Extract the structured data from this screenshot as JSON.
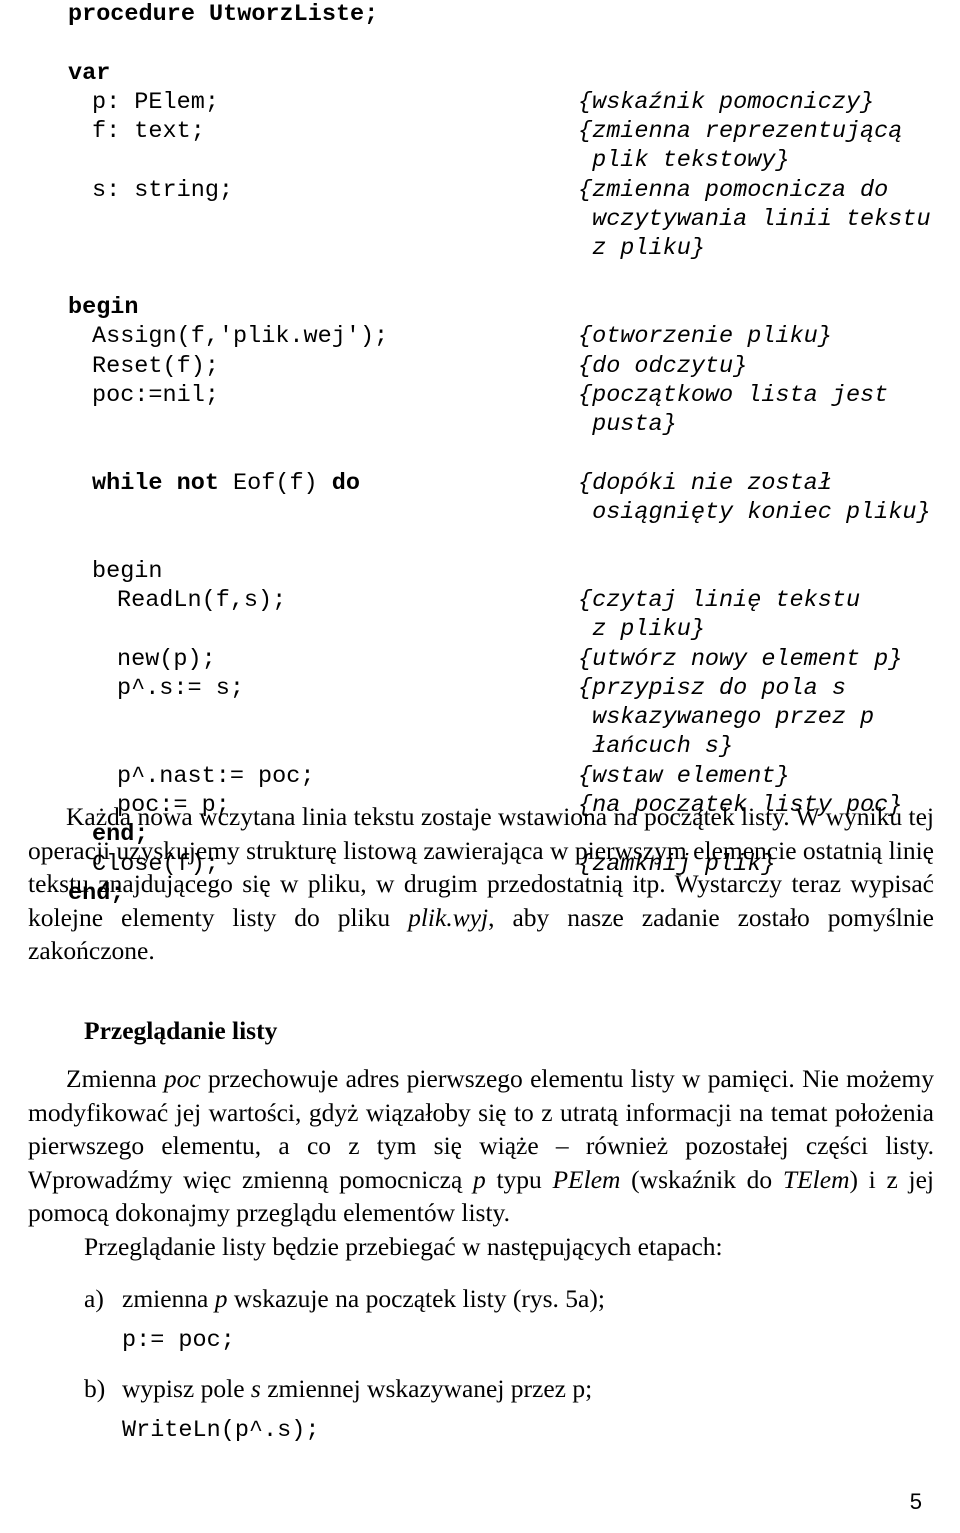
{
  "document": {
    "language": "pl",
    "page_number": "5"
  },
  "code_listing": {
    "name": "UtworzListe procedure",
    "lines": [
      {
        "indent": 0,
        "code": "procedure UtworzListe;",
        "bold": true,
        "comment": ""
      },
      {
        "indent": 0,
        "code": "",
        "bold": false,
        "comment": ""
      },
      {
        "indent": 0,
        "code": "var",
        "bold": true,
        "comment": ""
      },
      {
        "indent": 1,
        "code": "p: PElem;",
        "bold": false,
        "comment": "{wskaźnik pomocniczy}"
      },
      {
        "indent": 1,
        "code": "f: text;",
        "bold": false,
        "comment": "{zmienna reprezentującą"
      },
      {
        "indent": 0,
        "code": "",
        "bold": false,
        "comment": " plik tekstowy}"
      },
      {
        "indent": 1,
        "code": "s: string;",
        "bold": false,
        "comment": "{zmienna pomocnicza do"
      },
      {
        "indent": 0,
        "code": "",
        "bold": false,
        "comment": " wczytywania linii tekstu"
      },
      {
        "indent": 0,
        "code": "",
        "bold": false,
        "comment": " z pliku}"
      },
      {
        "indent": 0,
        "code": "",
        "bold": false,
        "comment": ""
      },
      {
        "indent": 0,
        "code": "begin",
        "bold": true,
        "comment": ""
      },
      {
        "indent": 1,
        "code": "Assign(f,'plik.wej');",
        "bold": false,
        "comment": "{otworzenie pliku}"
      },
      {
        "indent": 1,
        "code": "Reset(f);",
        "bold": false,
        "comment": "{do odczytu}"
      },
      {
        "indent": 1,
        "code": "poc:=nil;",
        "bold": false,
        "comment": "{początkowo lista jest"
      },
      {
        "indent": 0,
        "code": "",
        "bold": false,
        "comment": " pusta}"
      },
      {
        "indent": 0,
        "code": "",
        "bold": false,
        "comment": ""
      },
      {
        "indent": 1,
        "code": "while not Eof(f) do",
        "bold": false,
        "comment": "{dopóki nie został",
        "segments": [
          {
            "text": "while not ",
            "bold": true
          },
          {
            "text": "Eof(f) ",
            "bold": false
          },
          {
            "text": "do",
            "bold": true
          }
        ]
      },
      {
        "indent": 0,
        "code": "",
        "bold": false,
        "comment": " osiągnięty koniec pliku}"
      },
      {
        "indent": 0,
        "code": "",
        "bold": false,
        "comment": ""
      },
      {
        "indent": 1,
        "code": "begin",
        "bold": false,
        "comment": ""
      },
      {
        "indent": 2,
        "code": "ReadLn(f,s);",
        "bold": false,
        "comment": "{czytaj linię tekstu"
      },
      {
        "indent": 0,
        "code": "",
        "bold": false,
        "comment": " z pliku}"
      },
      {
        "indent": 2,
        "code": "new(p);",
        "bold": false,
        "comment": "{utwórz nowy element p}"
      },
      {
        "indent": 2,
        "code": "p^.s:= s;",
        "bold": false,
        "comment": "{przypisz do pola s"
      },
      {
        "indent": 0,
        "code": "",
        "bold": false,
        "comment": " wskazywanego przez p"
      },
      {
        "indent": 0,
        "code": "",
        "bold": false,
        "comment": " łańcuch s}"
      },
      {
        "indent": 2,
        "code": "p^.nast:= poc;",
        "bold": false,
        "comment": "{wstaw element}"
      },
      {
        "indent": 2,
        "code": "poc:= p;",
        "bold": false,
        "comment": "{na początek listy poc}"
      },
      {
        "indent": 1,
        "code": "end;",
        "bold": true,
        "comment": ""
      },
      {
        "indent": 1,
        "code": "Close(f);",
        "bold": false,
        "comment": "{zamknij plik}"
      },
      {
        "indent": 0,
        "code": "end;",
        "bold": true,
        "comment": ""
      }
    ]
  },
  "paragraphs": {
    "p1_part1": "Każda nowa wczytana linia tekstu zostaje wstawiona na początek listy. W wyniku tej operacji uzyskujemy strukturę listową zawierająca w pierwszym elemencie ostatnią linię tekstu znajdującego się w pliku, w drugim przedostatnią itp. Wystarczy teraz wypisać kolejne elementy listy do pliku ",
    "p1_italic": "plik.wyj",
    "p1_part2": ", aby nasze zadanie zostało pomyślnie zakończone."
  },
  "section": {
    "heading": "Przeglądanie listy",
    "p2_a": "Zmienna ",
    "p2_it1": "poc",
    "p2_b": " przechowuje adres pierwszego elementu listy w pamięci. Nie możemy modyfikować jej wartości, gdyż wiązałoby się to z utratą informacji na temat położenia pierwszego elementu, a co z tym się wiąże – również pozostałej części listy. Wprowadźmy więc zmienną pomocniczą ",
    "p2_it2": "p",
    "p2_c": " typu ",
    "p2_it3": "PElem",
    "p2_d": " (wskaźnik do ",
    "p2_it4": "TElem",
    "p2_e": ") i z jej pomocą dokonajmy przeglądu elementów listy.",
    "intro_steps": "Przeglądanie listy będzie przebiegać w następujących etapach:"
  },
  "steps": [
    {
      "marker": "a)",
      "text_a": "zmienna ",
      "text_it": "p",
      "text_b": " wskazuje na początek listy (rys. 5a);",
      "code": "p:= poc;"
    },
    {
      "marker": "b)",
      "text_a": "wypisz pole ",
      "text_it": "s",
      "text_b": " zmiennej wskazywanej przez p;",
      "code": "WriteLn(p^.s);"
    }
  ]
}
